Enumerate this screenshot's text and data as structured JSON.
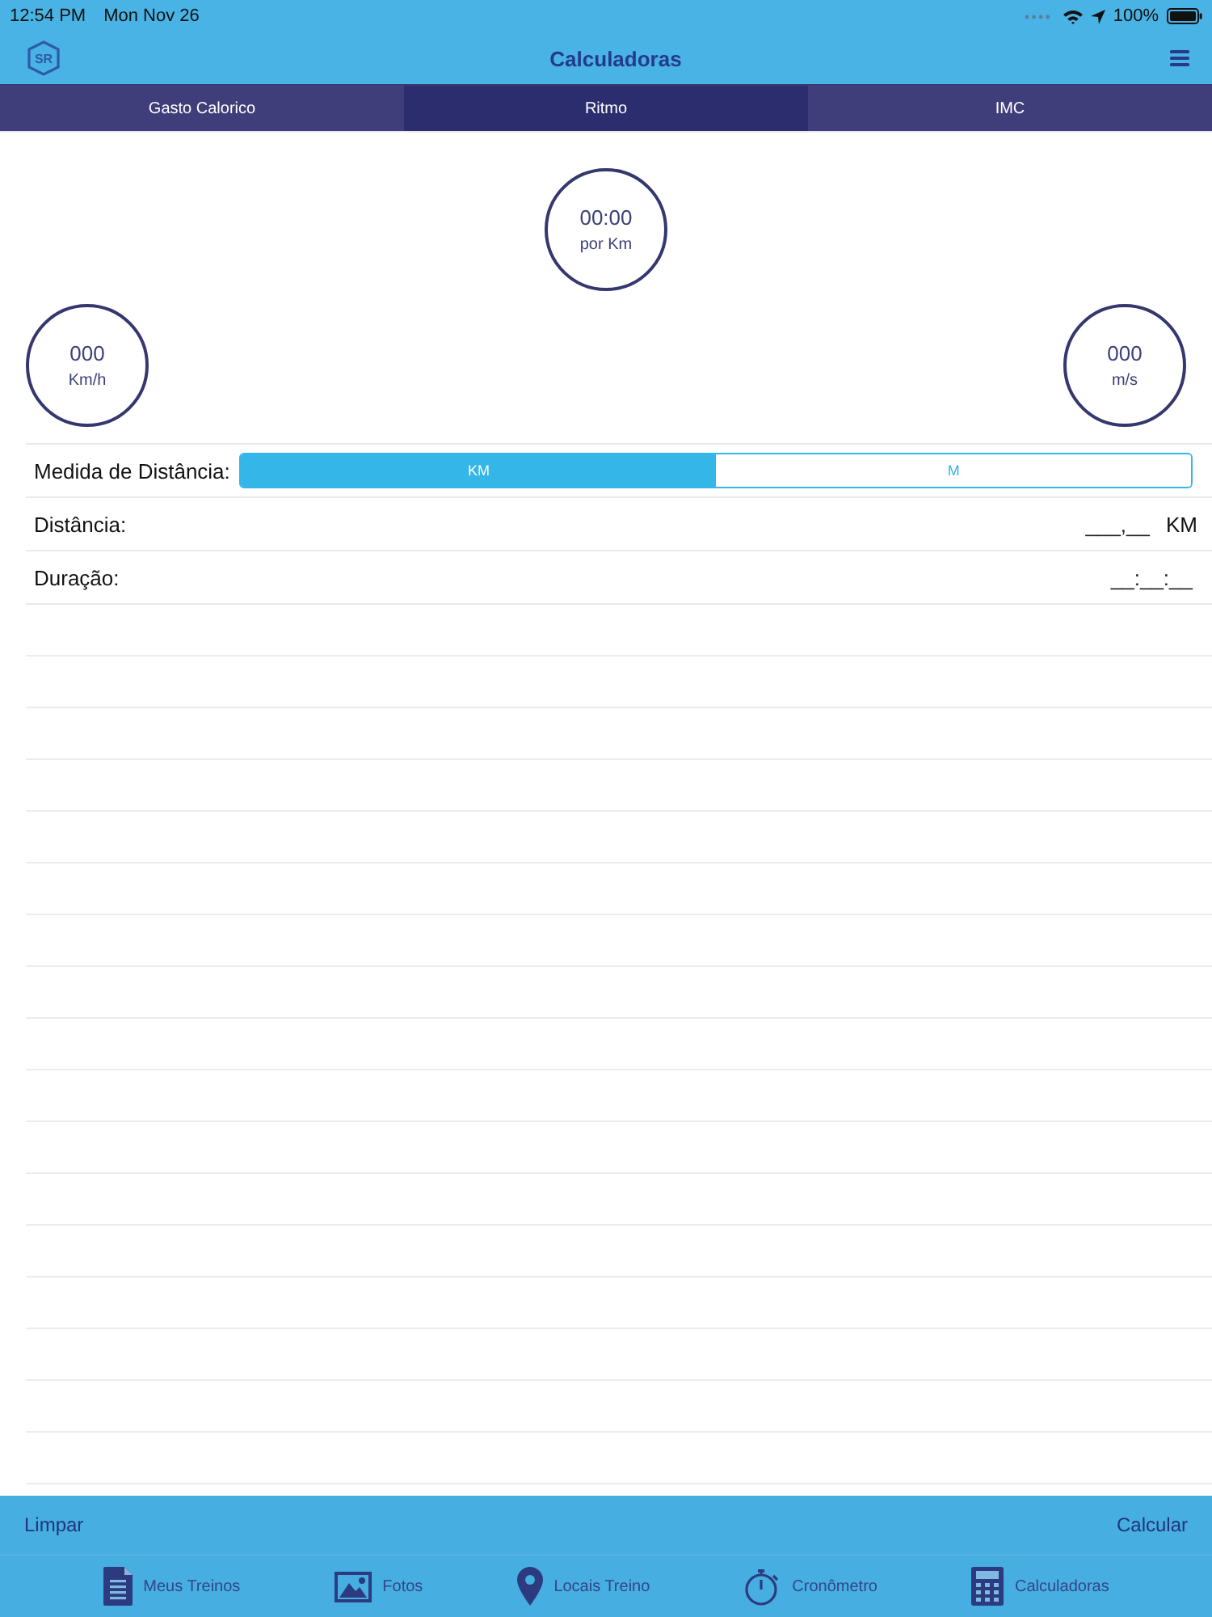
{
  "status_bar": {
    "time": "12:54 PM",
    "date": "Mon Nov 26",
    "battery": "100%"
  },
  "nav_bar": {
    "logo_text": "SR",
    "title": "Calculadoras"
  },
  "tabs": [
    {
      "label": "Gasto Calorico",
      "selected": false
    },
    {
      "label": "Ritmo",
      "selected": true
    },
    {
      "label": "IMC",
      "selected": false
    }
  ],
  "gauges": [
    {
      "value": "00:00",
      "unit": "por Km"
    },
    {
      "value": "000",
      "unit": "Km/h"
    },
    {
      "value": "000",
      "unit": "m/s"
    }
  ],
  "form": {
    "distance_unit": {
      "label": "Medida de Distância:",
      "options": [
        {
          "label": "KM",
          "selected": true
        },
        {
          "label": "M",
          "selected": false
        }
      ]
    },
    "fields": [
      {
        "label": "Distância:",
        "value": "___,__",
        "unit": "KM"
      },
      {
        "label": "Duração:",
        "value": "__:__:__"
      }
    ]
  },
  "toolbar": {
    "left": "Limpar",
    "right": "Calcular"
  },
  "tab_bar": [
    {
      "label": "Meus Treinos"
    },
    {
      "label": "Fotos"
    },
    {
      "label": "Locais Treino"
    },
    {
      "label": "Cronômetro"
    },
    {
      "label": "Calculadoras"
    }
  ]
}
